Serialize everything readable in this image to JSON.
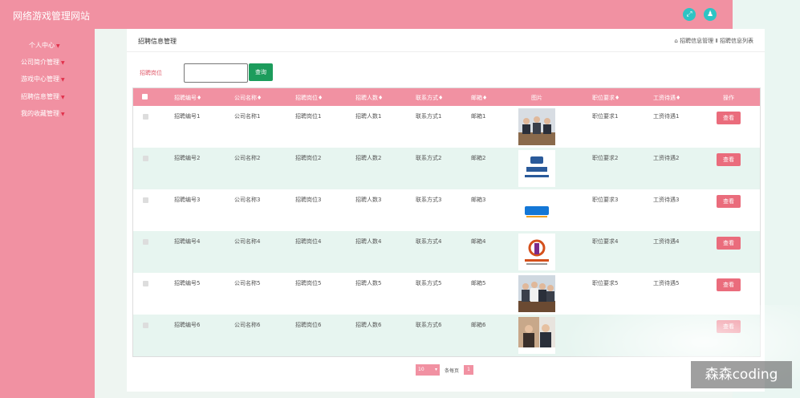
{
  "app": {
    "title": "网络游戏管理网站"
  },
  "sidebar": {
    "items": [
      {
        "label": "个人中心"
      },
      {
        "label": "公司简介管理"
      },
      {
        "label": "游戏中心管理"
      },
      {
        "label": "招聘信息管理"
      },
      {
        "label": "我的收藏管理"
      }
    ]
  },
  "panel": {
    "title": "招聘信息管理",
    "breadcrumb": "招聘信息管理 Ⅱ 招聘信息列表",
    "search": {
      "label": "招聘岗位",
      "value": "",
      "button": "查询"
    }
  },
  "table": {
    "headers": [
      "招聘编号♦",
      "公司名称♦",
      "招聘岗位♦",
      "招聘人数♦",
      "联系方式♦",
      "邮箱♦",
      "图片",
      "职位要求♦",
      "工资待遇♦",
      "操作"
    ],
    "rows": [
      {
        "code": "招聘编号1",
        "company": "公司名称1",
        "post": "招聘岗位1",
        "count": "招聘人数1",
        "contact": "联系方式1",
        "email": "邮箱1",
        "image": "meeting-photo",
        "req": "职位要求1",
        "salary": "工资待遇1",
        "action": "查看"
      },
      {
        "code": "招聘编号2",
        "company": "公司名称2",
        "post": "招聘岗位2",
        "count": "招聘人数2",
        "contact": "联系方式2",
        "email": "邮箱2",
        "image": "geely-auto-logo",
        "req": "职位要求2",
        "salary": "工资待遇2",
        "action": "查看"
      },
      {
        "code": "招聘编号3",
        "company": "公司名称3",
        "post": "招聘岗位3",
        "count": "招聘人数3",
        "contact": "联系方式3",
        "email": "邮箱3",
        "image": "alipay-logo",
        "req": "职位要求3",
        "salary": "工资待遇3",
        "action": "查看"
      },
      {
        "code": "招聘编号4",
        "company": "公司名称4",
        "post": "招聘岗位4",
        "count": "招聘人数4",
        "contact": "联系方式4",
        "email": "邮箱4",
        "image": "company-logo",
        "req": "职位要求4",
        "salary": "工资待遇4",
        "action": "查看"
      },
      {
        "code": "招聘编号5",
        "company": "公司名称5",
        "post": "招聘岗位5",
        "count": "招聘人数5",
        "contact": "联系方式5",
        "email": "邮箱5",
        "image": "team-photo",
        "req": "职位要求5",
        "salary": "工资待遇5",
        "action": "查看"
      },
      {
        "code": "招聘编号6",
        "company": "公司名称6",
        "post": "招聘岗位6",
        "count": "招聘人数6",
        "contact": "联系方式6",
        "email": "邮箱6",
        "image": "interview-photo",
        "req": "",
        "salary": "",
        "action": "查看"
      }
    ]
  },
  "pager": {
    "page_size": "10",
    "per_page_label": "条每页",
    "current_page": "1"
  },
  "watermark": "森森coding",
  "colors": {
    "accent": "#f191a2",
    "search_button": "#1c9c5c",
    "view_button": "#ea6c7c",
    "row_alt": "#e7f5f0"
  }
}
